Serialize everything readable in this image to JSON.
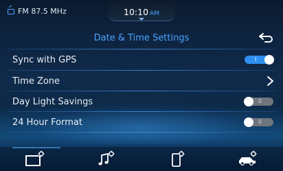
{
  "status": {
    "radio_label": "FM 87.5 MHz",
    "time": "10:10",
    "ampm": "AM"
  },
  "page": {
    "title": "Date & Time Settings"
  },
  "settings": [
    {
      "label": "Sync with GPS",
      "control": "toggle",
      "state": "on",
      "toggle_text": "I"
    },
    {
      "label": "Time Zone",
      "control": "chevron"
    },
    {
      "label": "Day Light Savings",
      "control": "toggle",
      "state": "off",
      "toggle_text": "0"
    },
    {
      "label": "24 Hour Format",
      "control": "toggle",
      "state": "off",
      "toggle_text": "0"
    }
  ],
  "nav": {
    "items": [
      {
        "icon": "radio-screen-icon",
        "active": true
      },
      {
        "icon": "music-icon",
        "active": false
      },
      {
        "icon": "phone-icon",
        "active": false
      },
      {
        "icon": "car-settings-icon",
        "active": false
      }
    ]
  },
  "colors": {
    "accent": "#4aa3ff",
    "toggle_on": "#2d8ef0",
    "toggle_off": "#6e757d",
    "text": "#e8eef5"
  }
}
